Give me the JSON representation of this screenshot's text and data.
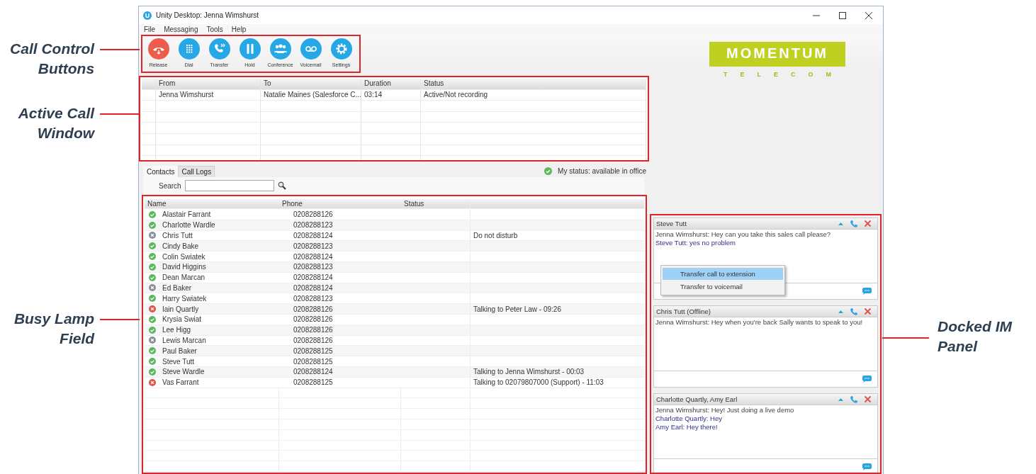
{
  "annotations_left": [
    "Call Control Buttons",
    "Active Call Window",
    "Busy Lamp Field"
  ],
  "annotations_right": [
    "Docked IM Panel"
  ],
  "window": {
    "title": "Unity Desktop: Jenna Wimshurst"
  },
  "menu": [
    "File",
    "Messaging",
    "Tools",
    "Help"
  ],
  "call_controls": [
    {
      "label": "Release",
      "kind": "release"
    },
    {
      "label": "Dial",
      "kind": "dial"
    },
    {
      "label": "Transfer",
      "kind": "transfer"
    },
    {
      "label": "Hold",
      "kind": "hold"
    },
    {
      "label": "Conference",
      "kind": "conference"
    },
    {
      "label": "Voicemail",
      "kind": "voicemail"
    },
    {
      "label": "Settings",
      "kind": "settings"
    }
  ],
  "logo": {
    "name": "MOMENTUM",
    "tagline": "TELECOM"
  },
  "active_calls": {
    "columns": [
      "From",
      "To",
      "Duration",
      "Status"
    ],
    "rows": [
      {
        "from": "Jenna Wimshurst",
        "to": "Natalie Maines (Salesforce C...",
        "duration": "03:14",
        "status": "Active/Not recording"
      }
    ]
  },
  "tabs": [
    {
      "label": "Contacts",
      "selected": true
    },
    {
      "label": "Call Logs",
      "selected": false
    }
  ],
  "my_status": {
    "text": "My status: available in office",
    "color": "#5cb85c"
  },
  "search": {
    "label": "Search"
  },
  "contacts": {
    "columns": [
      "Name",
      "Phone",
      "Status"
    ],
    "rows": [
      {
        "name": "Alastair Farrant",
        "phone": "0208288126",
        "kind": "check",
        "color": "#5cb85c"
      },
      {
        "name": "Charlotte Wardle",
        "phone": "0208288123",
        "kind": "check",
        "color": "#5cb85c"
      },
      {
        "name": "Chris Tutt",
        "phone": "0208288124",
        "kind": "cross",
        "color": "#8a8f99",
        "note": "Do not disturb"
      },
      {
        "name": "Cindy Bake",
        "phone": "0208288123",
        "kind": "check",
        "color": "#5cb85c"
      },
      {
        "name": "Colin Swiatek",
        "phone": "0208288124",
        "kind": "check",
        "color": "#5cb85c"
      },
      {
        "name": "David Higgins",
        "phone": "0208288123",
        "kind": "check",
        "color": "#5cb85c"
      },
      {
        "name": "Dean Marcan",
        "phone": "0208288124",
        "kind": "check",
        "color": "#5cb85c"
      },
      {
        "name": "Ed Baker",
        "phone": "0208288124",
        "kind": "cross",
        "color": "#8a8f99"
      },
      {
        "name": "Harry Swiatek",
        "phone": "0208288123",
        "kind": "check",
        "color": "#5cb85c"
      },
      {
        "name": "Iain Quartly",
        "phone": "0208288126",
        "kind": "cross",
        "color": "#e0544a",
        "note": "Talking to Peter Law - 09:26"
      },
      {
        "name": "Krysia Swiat",
        "phone": "0208288126",
        "kind": "check",
        "color": "#5cb85c"
      },
      {
        "name": "Lee Higg",
        "phone": "0208288126",
        "kind": "check",
        "color": "#5cb85c"
      },
      {
        "name": "Lewis Marcan",
        "phone": "0208288126",
        "kind": "cross",
        "color": "#8a8f99"
      },
      {
        "name": "Paul Baker",
        "phone": "0208288125",
        "kind": "check",
        "color": "#5cb85c"
      },
      {
        "name": "Steve Tutt",
        "phone": "0208288125",
        "kind": "check",
        "color": "#5cb85c"
      },
      {
        "name": "Steve Wardle",
        "phone": "0208288124",
        "kind": "check",
        "color": "#5cb85c",
        "note": "Talking to Jenna Wimshurst - 00:03"
      },
      {
        "name": "Vas Farrant",
        "phone": "0208288125",
        "kind": "cross",
        "color": "#e0544a",
        "note": "Talking to 02079807000 (Support) - 11:03"
      }
    ]
  },
  "im_panes": [
    {
      "title": "Steve Tutt",
      "messages": [
        {
          "text": "Jenna Wimshurst: Hey can you take this sales call please?",
          "kind": "self"
        },
        {
          "text": "Steve Tutt: yes no problem",
          "kind": "other"
        }
      ],
      "context_menu": [
        {
          "label": "Transfer call to extension",
          "selected": true
        },
        {
          "label": "Transfer to voicemail",
          "selected": false
        }
      ]
    },
    {
      "title": "Chris Tutt (Offline)",
      "messages": [
        {
          "text": "Jenna Wimshurst: Hey when you're back Sally wants to speak to you!",
          "kind": "self"
        }
      ]
    },
    {
      "title": "Charlotte Quartly, Amy Earl",
      "messages": [
        {
          "text": "Jenna Wimshurst: Hey! Just doing a live demo",
          "kind": "self"
        },
        {
          "text": "Charlotte Quartly: Hey",
          "kind": "other"
        },
        {
          "text": "Amy Earl: Hey there!",
          "kind": "other"
        }
      ]
    }
  ]
}
